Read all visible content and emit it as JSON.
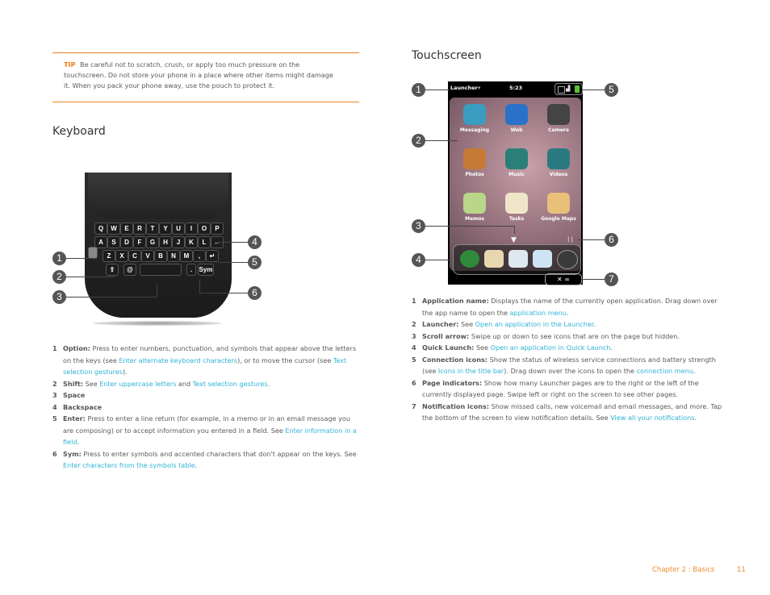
{
  "tip": {
    "label": "TIP",
    "text": "Be careful not to scratch, crush, or apply too much pressure on the touchscreen. Do not store your phone in a place where other items might damage it. When you pack your phone away, use the pouch to protect it."
  },
  "keyboard": {
    "heading": "Keyboard",
    "rows": [
      [
        "Q",
        "W",
        "E",
        "R",
        "T",
        "Y",
        "U",
        "I",
        "O",
        "P"
      ],
      [
        "A",
        "S",
        "D",
        "F",
        "G",
        "H",
        "J",
        "K",
        "L",
        "←"
      ],
      [
        "Z",
        "X",
        "C",
        "V",
        "B",
        "N",
        "M",
        ",",
        "↵"
      ],
      [
        "⇧",
        "@",
        "",
        ".",
        "Sym"
      ]
    ],
    "callouts": [
      "1",
      "2",
      "3",
      "4",
      "5",
      "6"
    ],
    "items": [
      {
        "num": "1",
        "term": "Option:",
        "pre": "Press to enter numbers, punctuation, and symbols that appear above the letters on the keys (see ",
        "link1": "Enter alternate keyboard characters",
        "mid": "), or to move the cursor (see ",
        "link2": "Text selection gestures",
        "post": ")."
      },
      {
        "num": "2",
        "term": "Shift:",
        "pre": "See ",
        "link1": "Enter uppercase letters",
        "mid": " and ",
        "link2": "Text selection gestures",
        "post": "."
      },
      {
        "num": "3",
        "term": "Space"
      },
      {
        "num": "4",
        "term": "Backspace"
      },
      {
        "num": "5",
        "term": "Enter:",
        "pre": "Press to enter a line return (for example, in a memo or in an email message you are composing) or to accept information you entered in a field. See ",
        "link1": "Enter information in a field",
        "post": "."
      },
      {
        "num": "6",
        "term": "Sym:",
        "pre": "Press to enter symbols and accented characters that don't appear on the keys. See ",
        "link1": "Enter characters from the symbols table",
        "post": "."
      }
    ]
  },
  "touchscreen": {
    "heading": "Touchscreen",
    "phone": {
      "app_name": "Launcher",
      "time": "5:23",
      "apps": [
        "Messaging",
        "Web",
        "Camera",
        "Photos",
        "Music",
        "Videos",
        "Memos",
        "Tasks",
        "Google Maps"
      ],
      "notif_glyphs": "✕ ∞"
    },
    "callouts": [
      "1",
      "2",
      "3",
      "4",
      "5",
      "6",
      "7"
    ],
    "items": [
      {
        "num": "1",
        "term": "Application name:",
        "pre": "Displays the name of the currently open application. Drag down over the app name to open the ",
        "link1": "application menu",
        "post": "."
      },
      {
        "num": "2",
        "term": "Launcher:",
        "pre": "See ",
        "link1": "Open an application in the Launcher",
        "post": "."
      },
      {
        "num": "3",
        "term": "Scroll arrow:",
        "pre": "Swipe up or down to see icons that are on the page but hidden."
      },
      {
        "num": "4",
        "term": "Quick Launch:",
        "pre": "See ",
        "link1": "Open an application in Quick Launch",
        "post": "."
      },
      {
        "num": "5",
        "term": "Connection icons:",
        "pre": "Show the status of wireless service connections and battery strength (see ",
        "link1": "Icons in the title bar",
        "mid": "). Drag down over the icons to open the ",
        "link2": "connection menu",
        "post": "."
      },
      {
        "num": "6",
        "term": "Page indicators:",
        "pre": "Show how many Launcher pages are to the right or the left of the currently displayed page. Swipe left or right on the screen to see other pages."
      },
      {
        "num": "7",
        "term": "Notification icons:",
        "pre": "Show missed calls, new voicemail and email messages, and more. Tap the bottom of the screen to view notification details. See ",
        "link1": "View all your notifications",
        "post": "."
      }
    ]
  },
  "footer": {
    "chapter": "Chapter 2  :  Basics",
    "page": "11"
  }
}
